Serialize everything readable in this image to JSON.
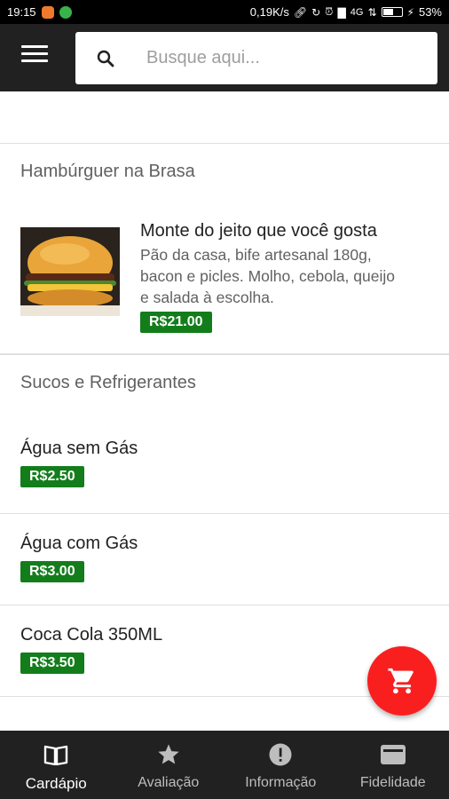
{
  "status_bar": {
    "time": "19:15",
    "network_speed": "0,19K/s",
    "network_type": "4G",
    "battery": "53%",
    "icons": [
      "link-icon",
      "sync-off-icon",
      "alarm-icon",
      "signal-icon",
      "wifi-off-icon",
      "battery-icon",
      "charging-icon"
    ]
  },
  "header": {
    "menu_icon": "hamburger-menu-icon",
    "search_placeholder": "Busque aqui..."
  },
  "sections": [
    {
      "title": "Hambúrguer na Brasa",
      "items": [
        {
          "name": "Monte do jeito que você gosta",
          "description_lines": [
            "Pão da casa, bife artesanal 180g,",
            "bacon e picles. Molho, cebola, queijo",
            "e salada à escolha."
          ],
          "price": "R$21.00"
        }
      ]
    },
    {
      "title": "Sucos e Refrigerantes",
      "items": [
        {
          "name": "Água sem Gás",
          "price": "R$2.50"
        },
        {
          "name": "Água com Gás",
          "price": "R$3.00"
        },
        {
          "name": "Coca Cola 350ML",
          "price": "R$3.50"
        }
      ]
    }
  ],
  "fab": {
    "icon": "cart-icon",
    "color": "#f91f1f"
  },
  "bottom_nav": [
    {
      "label": "Cardápio",
      "icon": "book-icon",
      "active": true
    },
    {
      "label": "Avaliação",
      "icon": "star-icon",
      "active": false
    },
    {
      "label": "Informação",
      "icon": "info-icon",
      "active": false
    },
    {
      "label": "Fidelidade",
      "icon": "card-icon",
      "active": false
    }
  ],
  "colors": {
    "appbar": "#212121",
    "price_badge": "#137d1b",
    "fab": "#f91f1f"
  }
}
